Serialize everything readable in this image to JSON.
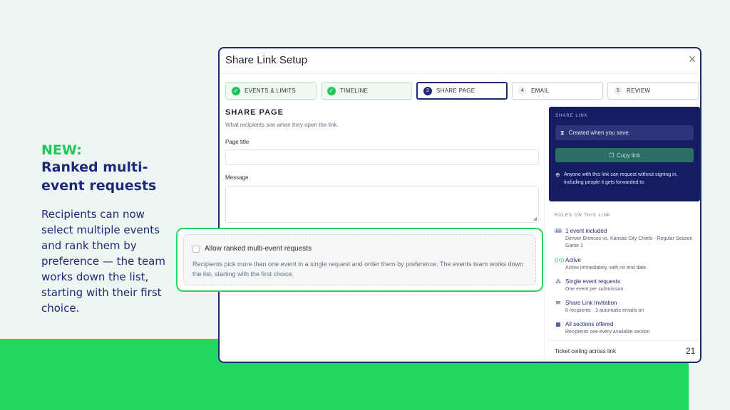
{
  "promo": {
    "tag": "NEW:",
    "title": "Ranked multi-event requests",
    "text": "Recipients can now select multiple events and rank them by preference — the team works down the list, starting with their first choice."
  },
  "modal": {
    "title": "Share Link Setup",
    "close_icon": "×",
    "steps": [
      {
        "label": "EVENTS & LIMITS",
        "state": "done"
      },
      {
        "label": "TIMELINE",
        "state": "done"
      },
      {
        "num": "3",
        "label": "SHARE PAGE",
        "state": "active"
      },
      {
        "num": "4",
        "label": "EMAIL",
        "state": "pending"
      },
      {
        "num": "5",
        "label": "REVIEW",
        "state": "pending"
      }
    ],
    "section_title": "SHARE PAGE",
    "section_sub": "What recipients see when they open the link.",
    "page_title_label": "Page title",
    "page_title_value": "",
    "message_label": "Message",
    "message_value": "",
    "ranked": {
      "label": "Allow ranked multi-event requests",
      "checked": false,
      "description": "Recipients pick more than one event in a single request and order them by preference. The events team works down the list, starting with the first choice."
    },
    "share_link": {
      "title": "SHARE LINK",
      "status": "Created when you save.",
      "copy_label": "Copy link",
      "note": "Anyone with this link can request without signing in, including people it gets forwarded to."
    },
    "rules": {
      "title": "RULES ON THIS LINK",
      "items": [
        {
          "icon": "ticket-icon",
          "title": "1 event included",
          "desc": "Denver Broncos vs. Kansas City Chiefs - Regular Season Game 1"
        },
        {
          "icon": "broadcast-icon",
          "title": "Active",
          "desc": "Active immediately, with no end date."
        },
        {
          "icon": "hierarchy-icon",
          "title": "Single event requests",
          "desc": "One event per submission"
        },
        {
          "icon": "envelope-icon",
          "title": "Share Link Invitation",
          "desc": "0 recipients · 3 automatic emails on"
        },
        {
          "icon": "grid-icon",
          "title": "All sections offered",
          "desc": "Recipients see every available section"
        }
      ]
    },
    "ceiling_label": "Ticket ceiling across link",
    "ceiling_value": "21"
  },
  "colors": {
    "navy": "#1e2a78",
    "accent_green": "#22c55e",
    "band_green": "#22d65e",
    "share_card_bg": "#141c63"
  }
}
